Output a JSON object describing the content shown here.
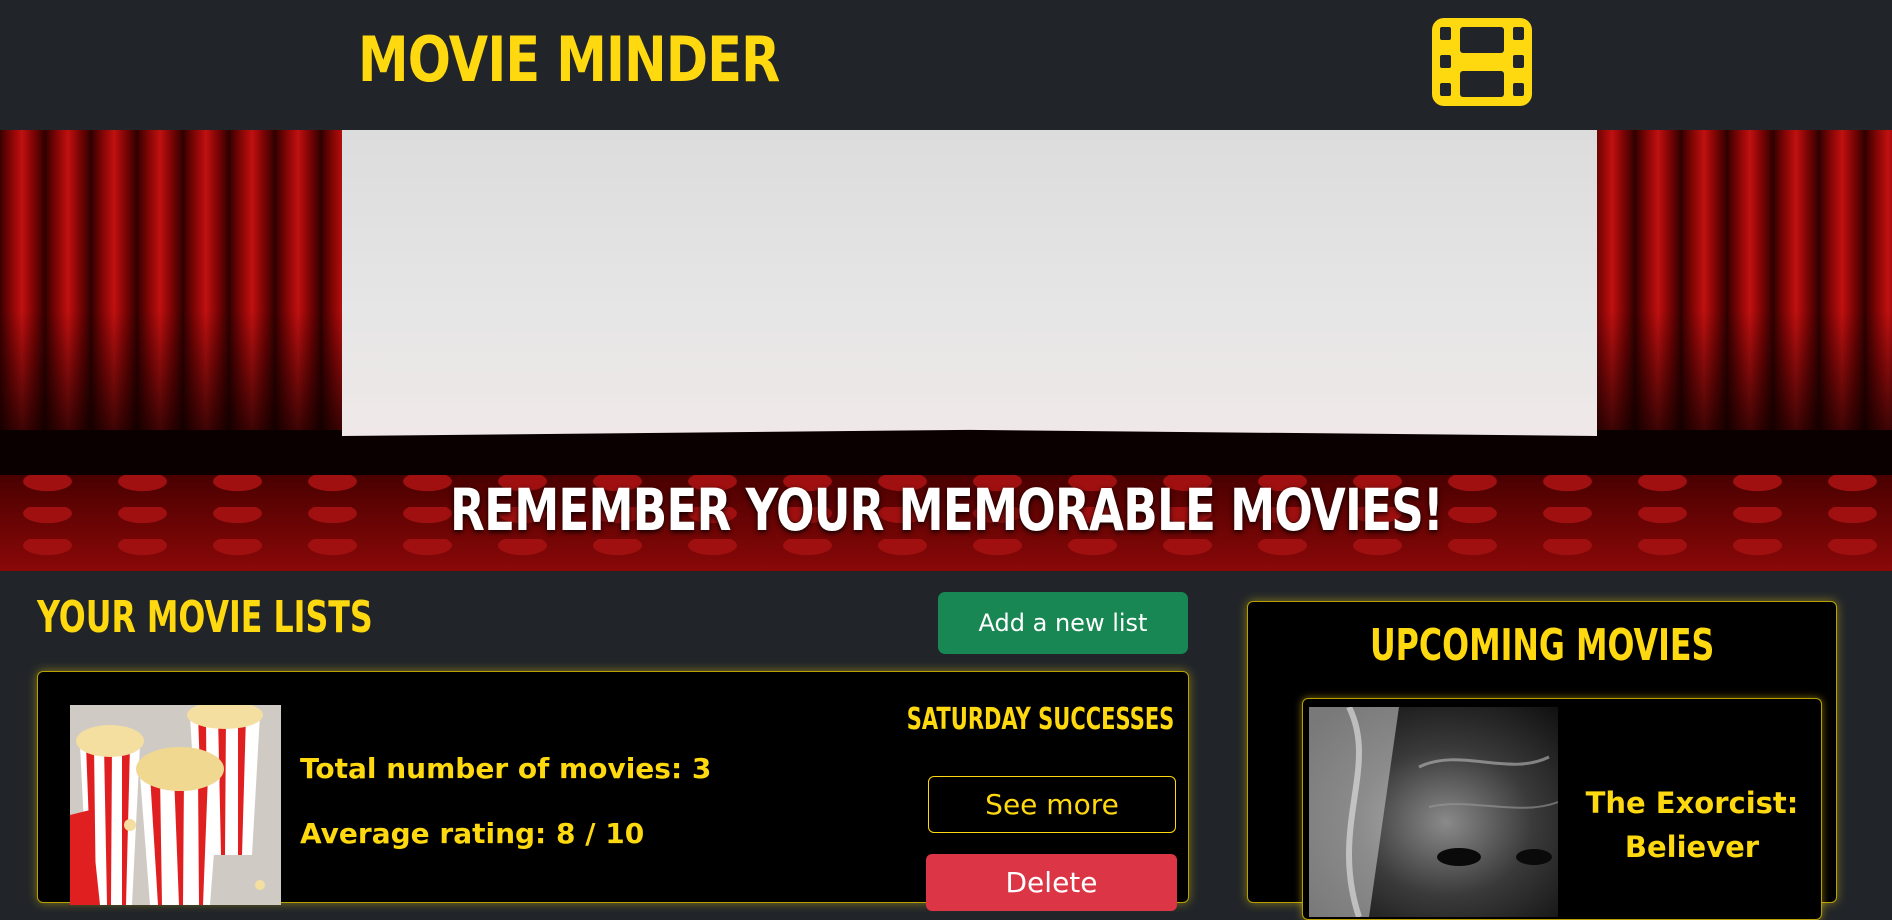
{
  "header": {
    "brand": "MOVIE MINDER",
    "icon": "film-icon",
    "accent_color": "#ffd90f"
  },
  "hero": {
    "tagline": "REMEMBER YOUR MEMORABLE MOVIES!"
  },
  "lists": {
    "title": "YOUR MOVIE LISTS",
    "add_label": "Add a new list",
    "items": [
      {
        "name": "SATURDAY SUCCESSES",
        "total_movies": "Total number of movies: 3",
        "average_rating": "Average rating: 8 / 10",
        "see_more_label": "See more",
        "delete_label": "Delete"
      }
    ]
  },
  "upcoming": {
    "title": "UPCOMING MOVIES",
    "movies": [
      {
        "title": "The Exorcist: Believer"
      }
    ]
  },
  "colors": {
    "background": "#212529",
    "success": "#198754",
    "danger": "#dc3545"
  }
}
